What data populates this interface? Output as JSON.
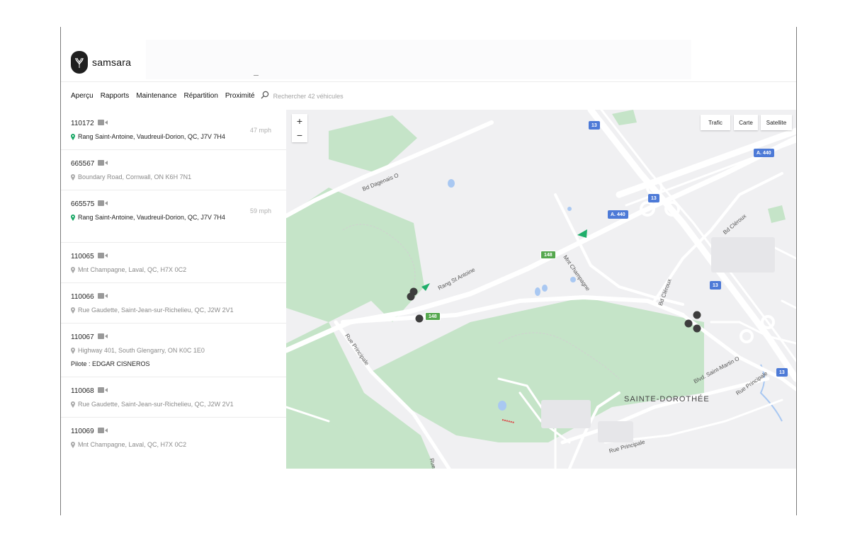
{
  "brand": {
    "name": "samsara"
  },
  "nav": {
    "items": [
      "Aperçu",
      "Rapports",
      "Maintenance",
      "Répartition",
      "Proximité"
    ],
    "search_placeholder": "Rechercher 42 véhicules"
  },
  "vehicles": [
    {
      "id": "110172",
      "address": "Rang Saint-Antoine, Vaudreuil-Dorion, QC, J7V 7H4",
      "speed": "47 mph",
      "active": true
    },
    {
      "id": "665567",
      "address": "Boundary Road, Cornwall, ON K6H 7N1",
      "active": false
    },
    {
      "id": "665575",
      "address": "Rang Saint-Antoine, Vaudreuil-Dorion, QC, J7V 7H4",
      "speed": "59 mph",
      "active": true
    },
    {
      "id": "110065",
      "address": "Mnt Champagne, Laval, QC,  H7X 0C2",
      "active": false
    },
    {
      "id": "110066",
      "address": "Rue Gaudette, Saint-Jean-sur-Richelieu, QC, J2W 2V1",
      "active": false
    },
    {
      "id": "110067",
      "address": "Highway 401, South Glengarry, ON K0C 1E0",
      "driver": "Pilote : EDGAR CISNEROS",
      "active": false
    },
    {
      "id": "110068",
      "address": "Rue Gaudette, Saint-Jean-sur-Richelieu, QC, J2W 2V1",
      "active": false
    },
    {
      "id": "110069",
      "address": "Mnt Champagne, Laval, QC,  H7X 0C2",
      "active": false
    }
  ],
  "map": {
    "zoom_in": "+",
    "zoom_out": "−",
    "buttons": {
      "traffic": "Trafic",
      "map": "Carte",
      "satellite": "Satellite"
    },
    "shields": {
      "r13": "13",
      "a440": "A. 440",
      "r148": "148"
    },
    "labels": {
      "bd_dagenais": "Bd Dagenais O",
      "rang_st_antoine": "Rang St Antoine",
      "mnt_champagne": "Mnt Champagne",
      "bd_cleroux": "Bd Cléroux",
      "rue_principale": "Rue Principale",
      "blvd_saint_martin": "Blvd. Saint-Martin O",
      "sainte_dorothee": "SAINTE-DOROTHÉE"
    },
    "colors": {
      "park": "#c5e4c8",
      "road": "#ffffff",
      "water": "#a9c8f2",
      "marker": "#3d3d3d",
      "arrow": "#1fae6a"
    }
  }
}
